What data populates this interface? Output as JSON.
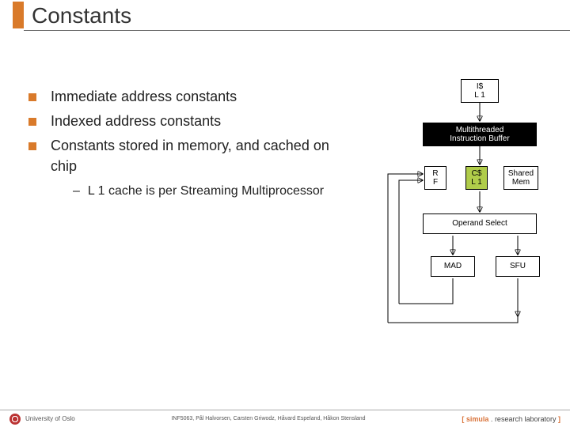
{
  "title": "Constants",
  "bullets": [
    "Immediate address constants",
    "Indexed address constants",
    "Constants stored in memory, and cached on chip"
  ],
  "sub_bullet": "L 1 cache is per Streaming Multiprocessor",
  "diagram": {
    "icache": "I$\nL 1",
    "mib": "Multithreaded\nInstruction Buffer",
    "rf": "R\nF",
    "cdl1": "C$\nL 1",
    "shared": "Shared\nMem",
    "operand": "Operand Select",
    "mad": "MAD",
    "sfu": "SFU"
  },
  "footer": {
    "uni": "University of Oslo",
    "course": "INF5063, Pål Halvorsen, Carsten Griwodz, Håvard Espeland, Håkon Stensland",
    "brand_open": "[",
    "brand_name": "simula",
    "brand_dot": ".",
    "brand_rest": "research laboratory",
    "brand_close": "]"
  }
}
